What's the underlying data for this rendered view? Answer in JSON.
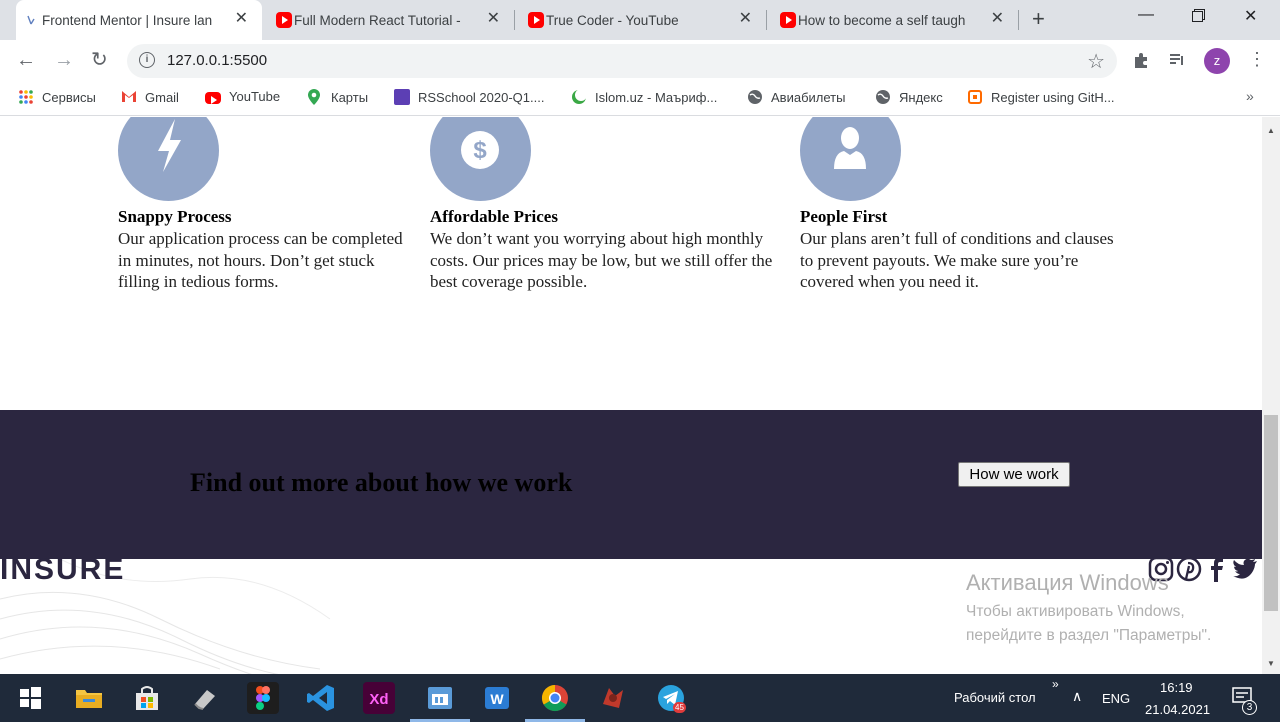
{
  "browser": {
    "tabs": [
      {
        "title": "Frontend Mentor | Insure lan",
        "favicon": "frontend-mentor"
      },
      {
        "title": "Full Modern React Tutorial - ",
        "favicon": "youtube"
      },
      {
        "title": "True Coder - YouTube",
        "favicon": "youtube"
      },
      {
        "title": "How to become a self taugh",
        "favicon": "youtube"
      }
    ],
    "url": "127.0.0.1:5500",
    "profile_initial": "z",
    "bookmarks": [
      "Сервисы",
      "Gmail",
      "YouTube",
      "Карты",
      "RSSchool 2020-Q1....",
      "Islom.uz - Маъриф...",
      "Авиабилеты",
      "Яндекс",
      "Register using GitH..."
    ],
    "bookmarks_more": "»"
  },
  "page": {
    "features": [
      {
        "title": "Snappy Process",
        "text": "Our application process can be completed in minutes, not hours. Don’t get stuck filling in tedious forms.",
        "icon": "lightning-icon"
      },
      {
        "title": "Affordable Prices",
        "text": "We don’t want you worrying about high monthly costs. Our prices may be low, but we still offer the best coverage possible.",
        "icon": "dollar-icon"
      },
      {
        "title": "People First",
        "text": "Our plans aren’t full of conditions and clauses to prevent payouts. We make sure you’re covered when you need it.",
        "icon": "person-icon"
      }
    ],
    "cta": {
      "heading": "Find out more about how we work",
      "button": "How we work"
    },
    "footer": {
      "logo": "INSURE"
    }
  },
  "os": {
    "activation_title": "Активация Windows",
    "activation_sub_1": "Чтобы активировать Windows,",
    "activation_sub_2": "перейдите в раздел \"Параметры\".",
    "desktop_label": "Рабочий стол",
    "desktop_chevron": "»",
    "lang": "ENG",
    "time": "16:19",
    "date": "21.04.2021",
    "telegram_badge": "45",
    "notification_count": "3"
  },
  "colors": {
    "feature_circle": "#93a6c8",
    "band": "#2b2640",
    "youtube": "#ff0000"
  }
}
